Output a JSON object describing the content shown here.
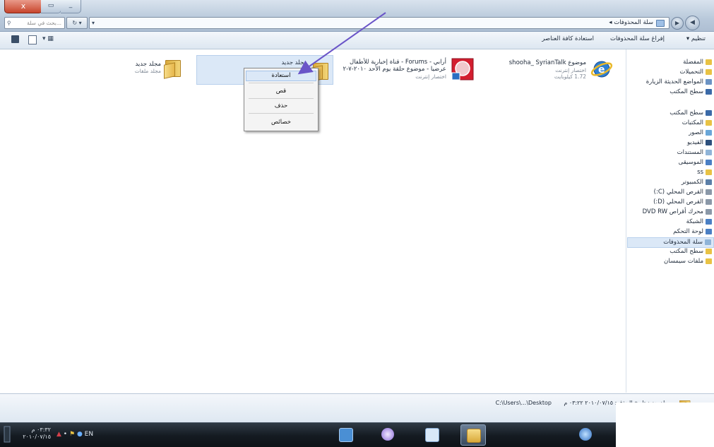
{
  "window": {
    "close_label": "x",
    "max_label": "▭",
    "min_label": "_"
  },
  "address": {
    "path": "سلة المحذوفات ◂",
    "search_placeholder": "بحث في سلة..."
  },
  "toolbar": {
    "organize": "تنظيم ▾",
    "empty_bin": "إفراغ سلة المحذوفات",
    "restore_all": "استعادة كافة العناصر"
  },
  "nav_pane": {
    "items": [
      {
        "label": "المفضلة",
        "color": "#e8c244"
      },
      {
        "label": "التحميلات",
        "color": "#e8c244"
      },
      {
        "label": "المواضع الحديثة الزيارة",
        "color": "#6b93c4"
      },
      {
        "label": "سطح المكتب",
        "color": "#3b6aa8"
      },
      {
        "label": "سطح المكتب",
        "color": "#3b6aa8"
      },
      {
        "label": "المكتبات",
        "color": "#e8c244"
      },
      {
        "label": "الصور",
        "color": "#69a6d8"
      },
      {
        "label": "الفيديو",
        "color": "#2c4f7c"
      },
      {
        "label": "المستندات",
        "color": "#8fb4d8"
      },
      {
        "label": "الموسيقى",
        "color": "#4a7fc4"
      },
      {
        "label": "ss",
        "color": "#e8c244"
      },
      {
        "label": "الكمبيوتر",
        "color": "#5b7fa8"
      },
      {
        "label": "القرص المحلي (C:)",
        "color": "#8a98a8"
      },
      {
        "label": "القرص المحلي (D:)",
        "color": "#8a98a8"
      },
      {
        "label": "محرك أقراص DVD RW",
        "color": "#8a98a8"
      },
      {
        "label": "الشبكة",
        "color": "#4a7fc4"
      },
      {
        "label": "لوحة التحكم",
        "color": "#4a7fc4"
      },
      {
        "label": "سلة المحذوفات",
        "color": "#8fb4d8",
        "selected": true
      },
      {
        "label": "سطح المكتب",
        "color": "#e8c244"
      },
      {
        "label": "ملفات سيمسان",
        "color": "#e8c244"
      }
    ]
  },
  "files": [
    {
      "name": "موضوع shooha_ SyrianTalk",
      "sub1": "اختصار إنترنت",
      "sub2": "1.72 كيلوبايت",
      "icon": "ie"
    },
    {
      "name": "أرابي - Forums - قناة إخبارية للأطفال",
      "sub1": "عرضيا - موضوع حلقة يوم الأحد ٢٠١٠-٧-٢",
      "sub2": "اختصار إنترنت",
      "icon": "shortcut"
    },
    {
      "name": "مجلد جديد",
      "sub1": "",
      "sub2": "",
      "icon": "folder"
    },
    {
      "name": "مجلد جديد",
      "sub1": "مجلد ملفات",
      "sub2": "",
      "icon": "folder"
    }
  ],
  "context_menu": {
    "items": [
      "استعادة",
      "قص",
      "حذف",
      "خصائص"
    ]
  },
  "details": {
    "text": "مجلد جديد  تاريخ الحذف: ٢٠١٠/٠٧/١٥ ٠٣:٢٢ م",
    "location": "C:\\Users\\...\\Desktop"
  },
  "taskbar": {
    "time": "٠٣:٣٢ م",
    "date": "٢٠١٠/٠٧/١٥",
    "lang": "EN"
  }
}
